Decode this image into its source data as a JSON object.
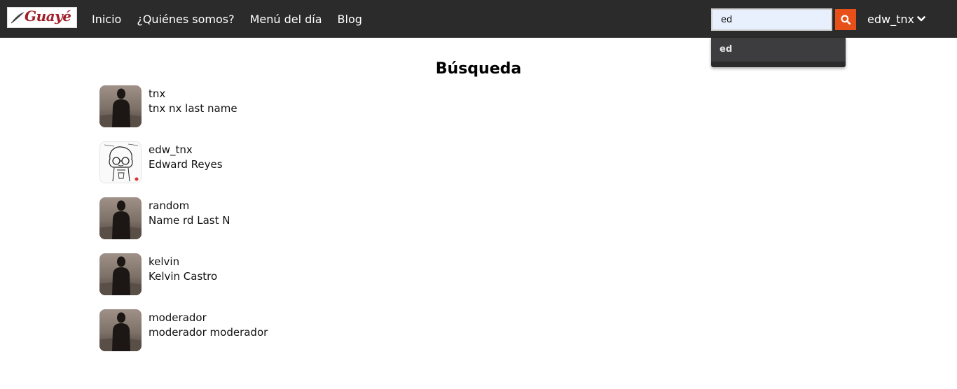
{
  "navbar": {
    "logo_text": "Guayé",
    "links": [
      "Inicio",
      "¿Quiénes somos?",
      "Menú del día",
      "Blog"
    ],
    "search": {
      "value": "ed",
      "placeholder": ""
    },
    "user": "edw_tnx",
    "colors": {
      "background": "#2b2b2b",
      "accent": "#e8501a"
    }
  },
  "suggestions": [
    "ed"
  ],
  "main": {
    "title": "Búsqueda",
    "results": [
      {
        "username": "tnx",
        "fullname": "tnx nx last name",
        "avatar": "silhouette-photo"
      },
      {
        "username": "edw_tnx",
        "fullname": "Edward Reyes",
        "avatar": "cartoon-drawing"
      },
      {
        "username": "random",
        "fullname": "Name rd Last N",
        "avatar": "silhouette-photo"
      },
      {
        "username": "kelvin",
        "fullname": "Kelvin Castro",
        "avatar": "silhouette-photo"
      },
      {
        "username": "moderador",
        "fullname": "moderador moderador",
        "avatar": "silhouette-photo"
      }
    ]
  }
}
